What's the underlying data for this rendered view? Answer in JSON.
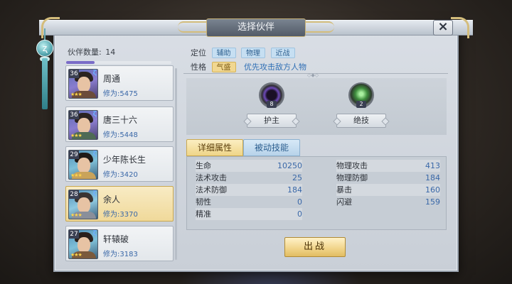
{
  "dialog": {
    "title": "选择伙伴",
    "close_icon": "×"
  },
  "partner_count": {
    "label": "伙伴数量:",
    "value": "14"
  },
  "partners": [
    {
      "level": "36",
      "name": "周通",
      "power": "修为:5475",
      "rank_icon": "ζ",
      "stars": "★★★",
      "selected": false
    },
    {
      "level": "36",
      "name": "唐三十六",
      "power": "修为:5448",
      "rank_icon": "ζ",
      "stars": "★★★",
      "selected": false
    },
    {
      "level": "29",
      "name": "少年陈长生",
      "power": "修为:3420",
      "rank_icon": "ζ",
      "stars": "★★★",
      "selected": false
    },
    {
      "level": "28",
      "name": "余人",
      "power": "修为:3370",
      "rank_icon": "ζ",
      "stars": "★★★",
      "selected": true
    },
    {
      "level": "27",
      "name": "轩辕破",
      "power": "修为:3183",
      "rank_icon": "ζ",
      "stars": "★★★",
      "selected": false
    }
  ],
  "profile": {
    "position_label": "定位",
    "position_tags": [
      "辅助",
      "物理",
      "近战"
    ],
    "trait_label": "性格",
    "trait_tag": "气盛",
    "trait_desc": "优先攻击敌方人物"
  },
  "skills": [
    {
      "label": "护主",
      "badge": "8"
    },
    {
      "label": "绝技",
      "badge": "2"
    }
  ],
  "tabs": {
    "active": "详细属性",
    "idle": "被动技能"
  },
  "stats_left": [
    {
      "name": "生命",
      "value": "10250"
    },
    {
      "name": "法术攻击",
      "value": "25"
    },
    {
      "name": "法术防御",
      "value": "184"
    },
    {
      "name": "韧性",
      "value": "0"
    },
    {
      "name": "精准",
      "value": "0"
    }
  ],
  "stats_right": [
    {
      "name": "物理攻击",
      "value": "413"
    },
    {
      "name": "物理防御",
      "value": "184"
    },
    {
      "name": "暴击",
      "value": "160"
    },
    {
      "name": "闪避",
      "value": "159"
    }
  ],
  "battle_button": "出战",
  "colors": {
    "accent_gold": "#f0d388",
    "value_blue": "#3a68a8",
    "panel": "#d9dee5"
  }
}
